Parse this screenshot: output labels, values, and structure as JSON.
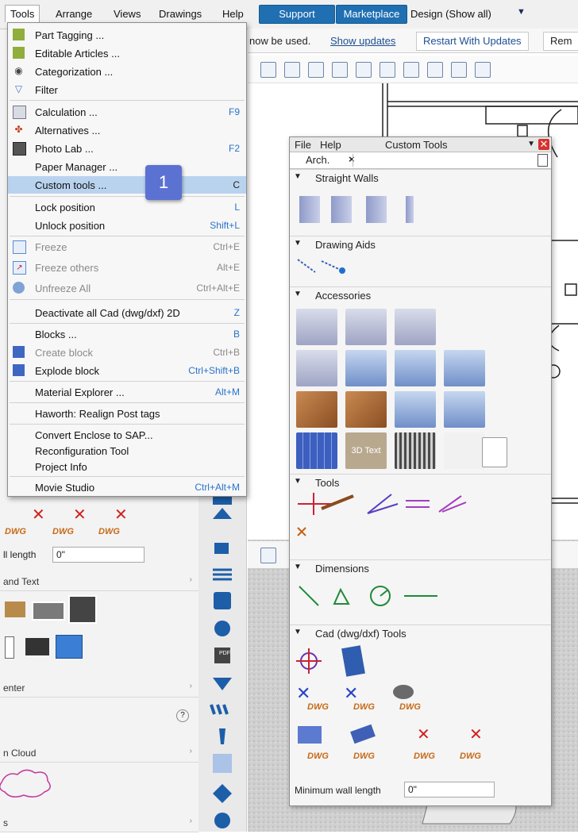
{
  "menubar": {
    "items": [
      "Tools",
      "Arrange",
      "Views",
      "Drawings",
      "Help"
    ],
    "support_label": "Support",
    "marketplace_label": "Marketplace",
    "design_label": "Design (Show all)"
  },
  "notice": {
    "text": "now be used.",
    "show_updates": "Show updates",
    "restart": "Restart With Updates",
    "remove": "Rem"
  },
  "tools_menu": {
    "items": [
      {
        "label": "Part Tagging ...",
        "shortcut": "",
        "icon": "tag-icon"
      },
      {
        "label": "Editable Articles ...",
        "shortcut": "",
        "icon": "article-icon"
      },
      {
        "label": "Categorization ...",
        "shortcut": "",
        "icon": "categorize-icon"
      },
      {
        "label": "Filter",
        "shortcut": "",
        "icon": "filter-icon"
      },
      {
        "label": "Calculation ...",
        "shortcut": "F9",
        "icon": "calculator-icon"
      },
      {
        "label": "Alternatives ...",
        "shortcut": "",
        "icon": "alternatives-icon"
      },
      {
        "label": "Photo Lab ...",
        "shortcut": "F2",
        "icon": "photo-icon"
      },
      {
        "label": "Paper Manager ...",
        "shortcut": "",
        "icon": ""
      },
      {
        "label": "Custom tools ...",
        "shortcut": "C",
        "icon": ""
      },
      {
        "label": "Lock position",
        "shortcut": "L",
        "icon": ""
      },
      {
        "label": "Unlock position",
        "shortcut": "Shift+L",
        "icon": ""
      },
      {
        "label": "Freeze",
        "shortcut": "Ctrl+E",
        "icon": "freeze-icon"
      },
      {
        "label": "Freeze others",
        "shortcut": "Alt+E",
        "icon": "freeze-others-icon"
      },
      {
        "label": "Unfreeze All",
        "shortcut": "Ctrl+Alt+E",
        "icon": "unfreeze-icon"
      },
      {
        "label": "Deactivate all Cad (dwg/dxf) 2D",
        "shortcut": "Z",
        "icon": ""
      },
      {
        "label": "Blocks ...",
        "shortcut": "B",
        "icon": ""
      },
      {
        "label": "Create block",
        "shortcut": "Ctrl+B",
        "icon": "create-block-icon"
      },
      {
        "label": "Explode block",
        "shortcut": "Ctrl+Shift+B",
        "icon": "explode-block-icon"
      },
      {
        "label": "Material Explorer ...",
        "shortcut": "Alt+M",
        "icon": ""
      },
      {
        "label": "Haworth: Realign Post tags",
        "shortcut": "",
        "icon": ""
      },
      {
        "label": "Convert Enclose to SAP...",
        "shortcut": "",
        "icon": ""
      },
      {
        "label": "Reconfiguration Tool",
        "shortcut": "",
        "icon": ""
      },
      {
        "label": "Project Info",
        "shortcut": "",
        "icon": ""
      },
      {
        "label": "Movie Studio",
        "shortcut": "Ctrl+Alt+M",
        "icon": ""
      }
    ],
    "badge": "1"
  },
  "custom_tools": {
    "menu_file": "File",
    "menu_help": "Help",
    "title": "Custom Tools",
    "tab": "Arch.",
    "tab_close": "×",
    "sections": {
      "straight_walls": "Straight Walls",
      "drawing_aids": "Drawing Aids",
      "accessories": "Accessories",
      "tools": "Tools",
      "dimensions": "Dimensions",
      "cad_tools": "Cad (dwg/dxf) Tools"
    },
    "text_3d": "3D Text",
    "dwg": "DWG",
    "min_wall_label": "Minimum wall length",
    "min_wall_value": "0\""
  },
  "left_panel": {
    "wall_length_label": "ll length",
    "wall_length_value": "0\"",
    "sec_text": "and Text",
    "sec_center": "enter",
    "sec_cloud": "n Cloud",
    "sec_last": "s",
    "dwg": "DWG",
    "help": "?",
    "pdf": "PDF"
  },
  "colors": {
    "accent_blue": "#1f6fb2",
    "menu_highlight": "#b9d3ef",
    "badge": "#5b72d3",
    "shortcut": "#2a73c9",
    "dwg_orange": "#c86a17"
  }
}
